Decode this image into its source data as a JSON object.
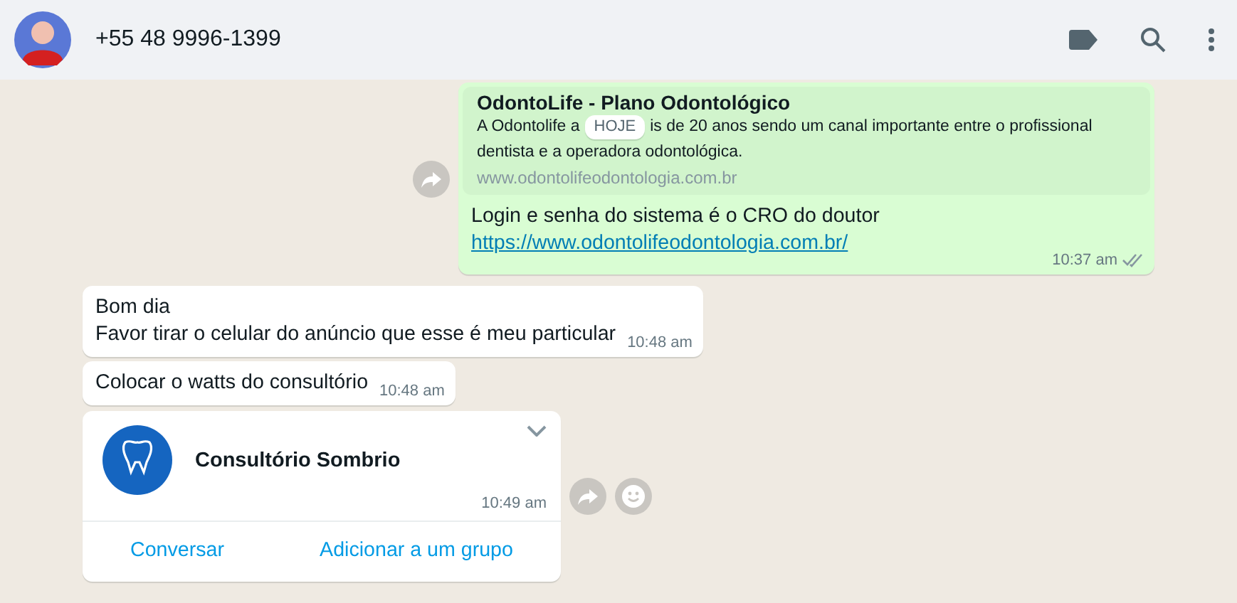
{
  "header": {
    "contact": "+55 48 9996-1399"
  },
  "date_badge": "HOJE",
  "messages": [
    {
      "kind": "link",
      "preview_title": "OdontoLife - Plano Odontológico",
      "preview_before": "A Odontolife a",
      "preview_after": "is de 20 anos sendo um canal importante entre o profissional",
      "preview_line2": "dentista e a operadora odontológica.",
      "preview_url": "www.odontolifeodontologia.com.br",
      "text": "Login e senha do sistema é o CRO do doutor",
      "link": "https://www.odontolifeodontologia.com.br/",
      "time": "10:37 am"
    },
    {
      "kind": "text",
      "lines": [
        "Bom dia",
        "Favor tirar o celular do anúncio que esse é meu particular"
      ],
      "time": "10:48 am"
    },
    {
      "kind": "text",
      "lines": [
        "Colocar o watts do consultório"
      ],
      "time": "10:48 am"
    },
    {
      "kind": "contact",
      "name": "Consultório Sombrio",
      "time": "10:49 am",
      "actions": [
        "Conversar",
        "Adicionar a um grupo"
      ]
    }
  ]
}
